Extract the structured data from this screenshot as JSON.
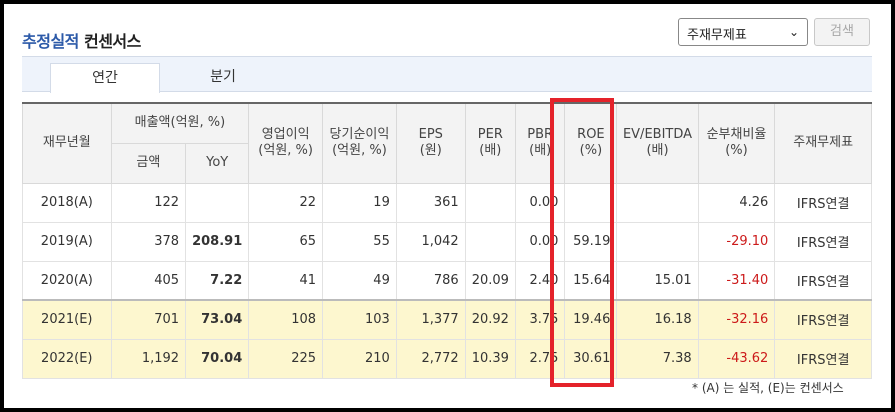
{
  "header": {
    "title_blue": "추정실적",
    "title_rest": "컨센서스",
    "select_value": "주재무제표",
    "search_label": "검색"
  },
  "tabs": [
    {
      "label": "연간",
      "active": true
    },
    {
      "label": "분기",
      "active": false
    }
  ],
  "table": {
    "headers": {
      "period": "재무년월",
      "sales": "매출액(억원, %)",
      "sales_amount": "금액",
      "sales_yoy": "YoY",
      "op_income": "영업이익\n(억원, %)",
      "net_income": "당기순이익\n(억원, %)",
      "eps": "EPS\n(원)",
      "per": "PER\n(배)",
      "pbr": "PBR\n(배)",
      "roe": "ROE\n(%)",
      "ev_ebitda": "EV/EBITDA\n(배)",
      "debt_ratio": "순부채비율\n(%)",
      "statement": "주재무제표"
    },
    "rows": [
      {
        "period": "2018(A)",
        "amount": "122",
        "yoy": "",
        "op": "22",
        "net": "19",
        "eps": "361",
        "per": "",
        "pbr": "0.00",
        "roe": "",
        "ev": "",
        "debt": "4.26",
        "stmt": "IFRS연결"
      },
      {
        "period": "2019(A)",
        "amount": "378",
        "yoy": "208.91",
        "op": "65",
        "net": "55",
        "eps": "1,042",
        "per": "",
        "pbr": "0.00",
        "roe": "59.19",
        "ev": "",
        "debt": "-29.10",
        "stmt": "IFRS연결"
      },
      {
        "period": "2020(A)",
        "amount": "405",
        "yoy": "7.22",
        "op": "41",
        "net": "49",
        "eps": "786",
        "per": "20.09",
        "pbr": "2.40",
        "roe": "15.64",
        "ev": "15.01",
        "debt": "-31.40",
        "stmt": "IFRS연결"
      },
      {
        "period": "2021(E)",
        "amount": "701",
        "yoy": "73.04",
        "op": "108",
        "net": "103",
        "eps": "1,377",
        "per": "20.92",
        "pbr": "3.75",
        "roe": "19.46",
        "ev": "16.18",
        "debt": "-32.16",
        "stmt": "IFRS연결"
      },
      {
        "period": "2022(E)",
        "amount": "1,192",
        "yoy": "70.04",
        "op": "225",
        "net": "210",
        "eps": "2,772",
        "per": "10.39",
        "pbr": "2.75",
        "roe": "30.61",
        "ev": "7.38",
        "debt": "-43.62",
        "stmt": "IFRS연결"
      }
    ]
  },
  "footnote": "* (A) 는 실적, (E)는 컨센서스",
  "colors": {
    "accent": "#2b59a8",
    "negative": "#cc1a1a",
    "estimate_bg": "#fdf7cf",
    "highlight": "#e4222a"
  }
}
